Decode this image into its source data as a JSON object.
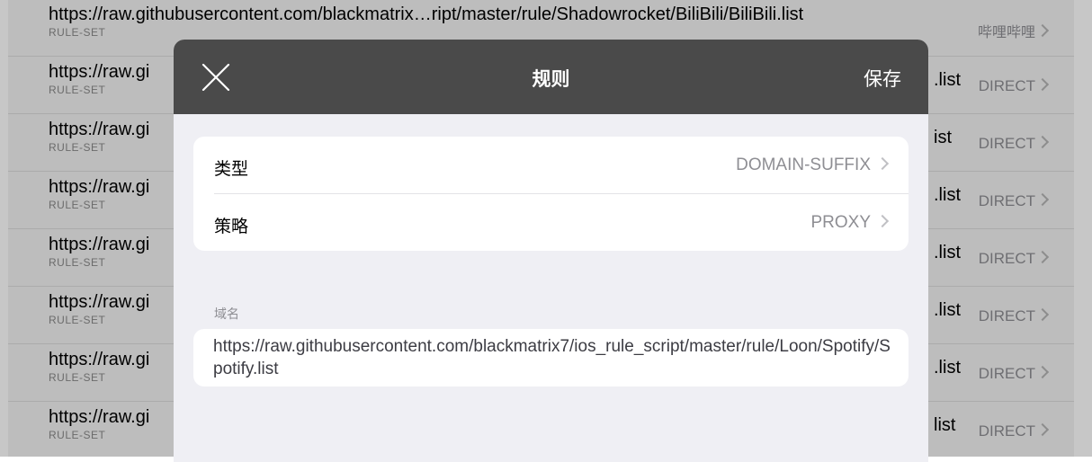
{
  "background_list": {
    "rows": [
      {
        "url": "https://raw.githubusercontent.com/blackmatrix…ript/master/rule/Shadowrocket/BiliBili/BiliBili.list",
        "type": "RULE-SET",
        "policy": "哔哩哔哩",
        "suffix": ""
      },
      {
        "url": "https://raw.gi",
        "type": "RULE-SET",
        "policy": "DIRECT",
        "suffix": ".list"
      },
      {
        "url": "https://raw.gi",
        "type": "RULE-SET",
        "policy": "DIRECT",
        "suffix": "ist"
      },
      {
        "url": "https://raw.gi",
        "type": "RULE-SET",
        "policy": "DIRECT",
        "suffix": ".list"
      },
      {
        "url": "https://raw.gi",
        "type": "RULE-SET",
        "policy": "DIRECT",
        "suffix": ".list"
      },
      {
        "url": "https://raw.gi",
        "type": "RULE-SET",
        "policy": "DIRECT",
        "suffix": ".list"
      },
      {
        "url": "https://raw.gi",
        "type": "RULE-SET",
        "policy": "DIRECT",
        "suffix": ".list"
      },
      {
        "url": "https://raw.gi",
        "type": "RULE-SET",
        "policy": "DIRECT",
        "suffix": "list"
      }
    ]
  },
  "modal": {
    "title": "规则",
    "save_label": "保存",
    "close_icon": "close-icon",
    "rows": [
      {
        "label": "类型",
        "value": "DOMAIN-SUFFIX"
      },
      {
        "label": "策略",
        "value": "PROXY"
      }
    ],
    "domain_section_label": "域名",
    "domain_value": "https://raw.githubusercontent.com/blackmatrix7/ios_rule_script/master/rule/Loon/Spotify/Spotify.list"
  },
  "colors": {
    "header_bg": "#4a4a4a",
    "modal_bg": "#efeff4",
    "secondary_text": "#8e8e93"
  }
}
